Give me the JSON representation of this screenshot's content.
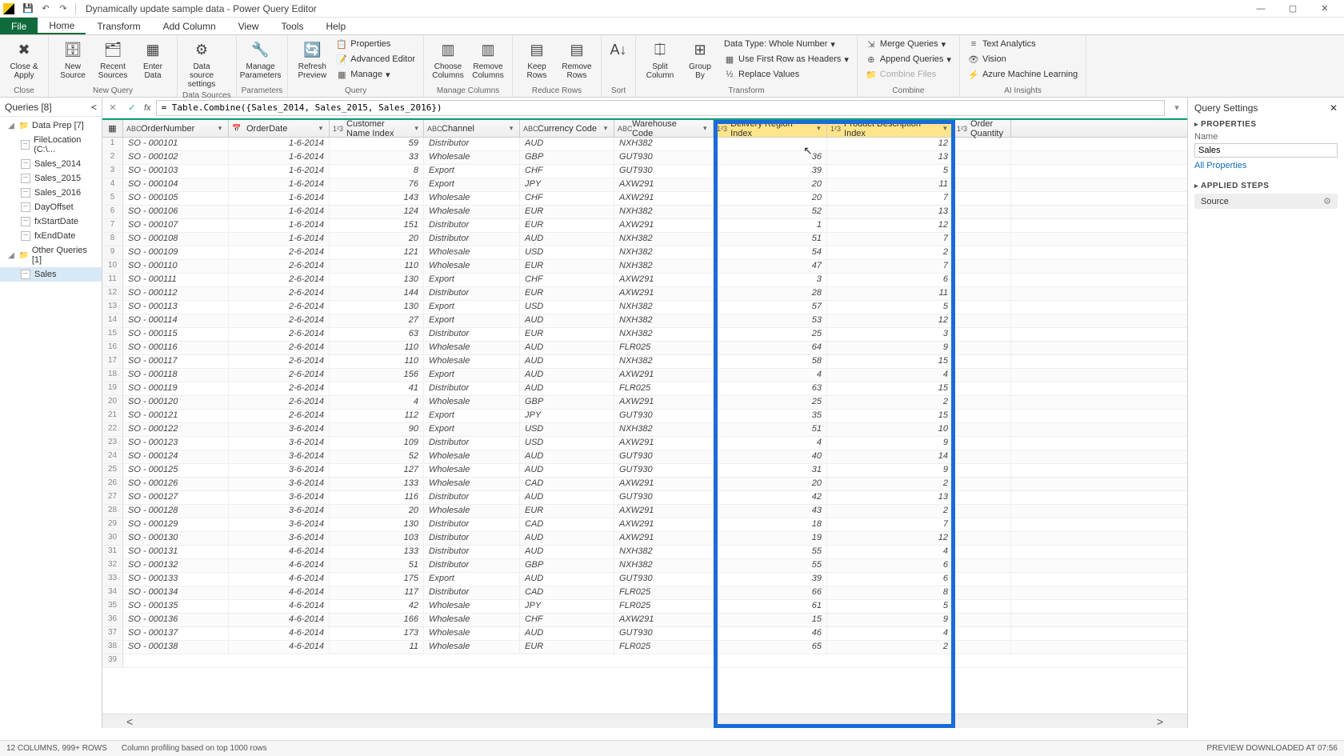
{
  "window": {
    "title": "Dynamically update sample data - Power Query Editor"
  },
  "tabs": {
    "file": "File",
    "home": "Home",
    "transform": "Transform",
    "addcol": "Add Column",
    "view": "View",
    "tools": "Tools",
    "help": "Help"
  },
  "ribbon": {
    "close_apply": "Close &\nApply",
    "close_group": "Close",
    "new_source": "New\nSource",
    "recent_sources": "Recent\nSources",
    "enter_data": "Enter\nData",
    "new_query_group": "New Query",
    "ds_settings": "Data source\nsettings",
    "ds_group": "Data Sources",
    "manage_params": "Manage\nParameters",
    "params_group": "Parameters",
    "refresh": "Refresh\nPreview",
    "properties": "Properties",
    "adv_editor": "Advanced Editor",
    "manage": "Manage",
    "query_group": "Query",
    "choose_cols": "Choose\nColumns",
    "remove_cols": "Remove\nColumns",
    "mc_group": "Manage Columns",
    "keep_rows": "Keep\nRows",
    "remove_rows": "Remove\nRows",
    "rr_group": "Reduce Rows",
    "sort_group": "Sort",
    "split_col": "Split\nColumn",
    "group_by": "Group\nBy",
    "datatype": "Data Type: Whole Number",
    "first_row": "Use First Row as Headers",
    "replace": "Replace Values",
    "transform_group": "Transform",
    "merge_q": "Merge Queries",
    "append_q": "Append Queries",
    "combine_files": "Combine Files",
    "combine_group": "Combine",
    "text_an": "Text Analytics",
    "vision": "Vision",
    "azure_ml": "Azure Machine Learning",
    "ai_group": "AI Insights"
  },
  "queries": {
    "header": "Queries [8]",
    "folder1": "Data Prep [7]",
    "items1": [
      "FileLocation (C:\\...",
      "Sales_2014",
      "Sales_2015",
      "Sales_2016",
      "DayOffset",
      "fxStartDate",
      "fxEndDate"
    ],
    "folder2": "Other Queries [1]",
    "items2": [
      "Sales"
    ]
  },
  "formula": "= Table.Combine({Sales_2014, Sales_2015, Sales_2016})",
  "columns": {
    "ordernum": "OrderNumber",
    "date": "OrderDate",
    "custidx": "Customer Name Index",
    "channel": "Channel",
    "curr": "Currency Code",
    "wh": "Warehouse Code",
    "delidx": "Delivery Region Index",
    "prodidx": "Product Description Index",
    "qty": "Order Quantity"
  },
  "rows": [
    {
      "n": 1,
      "on": "SO - 000101",
      "dt": "1-6-2014",
      "ci": 59,
      "ch": "Distributor",
      "cc": "AUD",
      "wh": "NXH382",
      "di": "",
      "pi": 12
    },
    {
      "n": 2,
      "on": "SO - 000102",
      "dt": "1-6-2014",
      "ci": 33,
      "ch": "Wholesale",
      "cc": "GBP",
      "wh": "GUT930",
      "di": 36,
      "pi": 13
    },
    {
      "n": 3,
      "on": "SO - 000103",
      "dt": "1-6-2014",
      "ci": 8,
      "ch": "Export",
      "cc": "CHF",
      "wh": "GUT930",
      "di": 39,
      "pi": 5
    },
    {
      "n": 4,
      "on": "SO - 000104",
      "dt": "1-6-2014",
      "ci": 76,
      "ch": "Export",
      "cc": "JPY",
      "wh": "AXW291",
      "di": 20,
      "pi": 11
    },
    {
      "n": 5,
      "on": "SO - 000105",
      "dt": "1-6-2014",
      "ci": 143,
      "ch": "Wholesale",
      "cc": "CHF",
      "wh": "AXW291",
      "di": 20,
      "pi": 7
    },
    {
      "n": 6,
      "on": "SO - 000106",
      "dt": "1-6-2014",
      "ci": 124,
      "ch": "Wholesale",
      "cc": "EUR",
      "wh": "NXH382",
      "di": 52,
      "pi": 13
    },
    {
      "n": 7,
      "on": "SO - 000107",
      "dt": "1-6-2014",
      "ci": 151,
      "ch": "Distributor",
      "cc": "EUR",
      "wh": "AXW291",
      "di": 1,
      "pi": 12
    },
    {
      "n": 8,
      "on": "SO - 000108",
      "dt": "1-6-2014",
      "ci": 20,
      "ch": "Distributor",
      "cc": "AUD",
      "wh": "NXH382",
      "di": 51,
      "pi": 7
    },
    {
      "n": 9,
      "on": "SO - 000109",
      "dt": "2-6-2014",
      "ci": 121,
      "ch": "Wholesale",
      "cc": "USD",
      "wh": "NXH382",
      "di": 54,
      "pi": 2
    },
    {
      "n": 10,
      "on": "SO - 000110",
      "dt": "2-6-2014",
      "ci": 110,
      "ch": "Wholesale",
      "cc": "EUR",
      "wh": "NXH382",
      "di": 47,
      "pi": 7
    },
    {
      "n": 11,
      "on": "SO - 000111",
      "dt": "2-6-2014",
      "ci": 130,
      "ch": "Export",
      "cc": "CHF",
      "wh": "AXW291",
      "di": 3,
      "pi": 6
    },
    {
      "n": 12,
      "on": "SO - 000112",
      "dt": "2-6-2014",
      "ci": 144,
      "ch": "Distributor",
      "cc": "EUR",
      "wh": "AXW291",
      "di": 28,
      "pi": 11
    },
    {
      "n": 13,
      "on": "SO - 000113",
      "dt": "2-6-2014",
      "ci": 130,
      "ch": "Export",
      "cc": "USD",
      "wh": "NXH382",
      "di": 57,
      "pi": 5
    },
    {
      "n": 14,
      "on": "SO - 000114",
      "dt": "2-6-2014",
      "ci": 27,
      "ch": "Export",
      "cc": "AUD",
      "wh": "NXH382",
      "di": 53,
      "pi": 12
    },
    {
      "n": 15,
      "on": "SO - 000115",
      "dt": "2-6-2014",
      "ci": 63,
      "ch": "Distributor",
      "cc": "EUR",
      "wh": "NXH382",
      "di": 25,
      "pi": 3
    },
    {
      "n": 16,
      "on": "SO - 000116",
      "dt": "2-6-2014",
      "ci": 110,
      "ch": "Wholesale",
      "cc": "AUD",
      "wh": "FLR025",
      "di": 64,
      "pi": 9
    },
    {
      "n": 17,
      "on": "SO - 000117",
      "dt": "2-6-2014",
      "ci": 110,
      "ch": "Wholesale",
      "cc": "AUD",
      "wh": "NXH382",
      "di": 58,
      "pi": 15
    },
    {
      "n": 18,
      "on": "SO - 000118",
      "dt": "2-6-2014",
      "ci": 156,
      "ch": "Export",
      "cc": "AUD",
      "wh": "AXW291",
      "di": 4,
      "pi": 4
    },
    {
      "n": 19,
      "on": "SO - 000119",
      "dt": "2-6-2014",
      "ci": 41,
      "ch": "Distributor",
      "cc": "AUD",
      "wh": "FLR025",
      "di": 63,
      "pi": 15
    },
    {
      "n": 20,
      "on": "SO - 000120",
      "dt": "2-6-2014",
      "ci": 4,
      "ch": "Wholesale",
      "cc": "GBP",
      "wh": "AXW291",
      "di": 25,
      "pi": 2
    },
    {
      "n": 21,
      "on": "SO - 000121",
      "dt": "2-6-2014",
      "ci": 112,
      "ch": "Export",
      "cc": "JPY",
      "wh": "GUT930",
      "di": 35,
      "pi": 15
    },
    {
      "n": 22,
      "on": "SO - 000122",
      "dt": "3-6-2014",
      "ci": 90,
      "ch": "Export",
      "cc": "USD",
      "wh": "NXH382",
      "di": 51,
      "pi": 10
    },
    {
      "n": 23,
      "on": "SO - 000123",
      "dt": "3-6-2014",
      "ci": 109,
      "ch": "Distributor",
      "cc": "USD",
      "wh": "AXW291",
      "di": 4,
      "pi": 9
    },
    {
      "n": 24,
      "on": "SO - 000124",
      "dt": "3-6-2014",
      "ci": 52,
      "ch": "Wholesale",
      "cc": "AUD",
      "wh": "GUT930",
      "di": 40,
      "pi": 14
    },
    {
      "n": 25,
      "on": "SO - 000125",
      "dt": "3-6-2014",
      "ci": 127,
      "ch": "Wholesale",
      "cc": "AUD",
      "wh": "GUT930",
      "di": 31,
      "pi": 9
    },
    {
      "n": 26,
      "on": "SO - 000126",
      "dt": "3-6-2014",
      "ci": 133,
      "ch": "Wholesale",
      "cc": "CAD",
      "wh": "AXW291",
      "di": 20,
      "pi": 2
    },
    {
      "n": 27,
      "on": "SO - 000127",
      "dt": "3-6-2014",
      "ci": 116,
      "ch": "Distributor",
      "cc": "AUD",
      "wh": "GUT930",
      "di": 42,
      "pi": 13
    },
    {
      "n": 28,
      "on": "SO - 000128",
      "dt": "3-6-2014",
      "ci": 20,
      "ch": "Wholesale",
      "cc": "EUR",
      "wh": "AXW291",
      "di": 43,
      "pi": 2
    },
    {
      "n": 29,
      "on": "SO - 000129",
      "dt": "3-6-2014",
      "ci": 130,
      "ch": "Distributor",
      "cc": "CAD",
      "wh": "AXW291",
      "di": 18,
      "pi": 7
    },
    {
      "n": 30,
      "on": "SO - 000130",
      "dt": "3-6-2014",
      "ci": 103,
      "ch": "Distributor",
      "cc": "AUD",
      "wh": "AXW291",
      "di": 19,
      "pi": 12
    },
    {
      "n": 31,
      "on": "SO - 000131",
      "dt": "4-6-2014",
      "ci": 133,
      "ch": "Distributor",
      "cc": "AUD",
      "wh": "NXH382",
      "di": 55,
      "pi": 4
    },
    {
      "n": 32,
      "on": "SO - 000132",
      "dt": "4-6-2014",
      "ci": 51,
      "ch": "Distributor",
      "cc": "GBP",
      "wh": "NXH382",
      "di": 55,
      "pi": 6
    },
    {
      "n": 33,
      "on": "SO - 000133",
      "dt": "4-6-2014",
      "ci": 175,
      "ch": "Export",
      "cc": "AUD",
      "wh": "GUT930",
      "di": 39,
      "pi": 6
    },
    {
      "n": 34,
      "on": "SO - 000134",
      "dt": "4-6-2014",
      "ci": 117,
      "ch": "Distributor",
      "cc": "CAD",
      "wh": "FLR025",
      "di": 66,
      "pi": 8
    },
    {
      "n": 35,
      "on": "SO - 000135",
      "dt": "4-6-2014",
      "ci": 42,
      "ch": "Wholesale",
      "cc": "JPY",
      "wh": "FLR025",
      "di": 61,
      "pi": 5
    },
    {
      "n": 36,
      "on": "SO - 000136",
      "dt": "4-6-2014",
      "ci": 166,
      "ch": "Wholesale",
      "cc": "CHF",
      "wh": "AXW291",
      "di": 15,
      "pi": 9
    },
    {
      "n": 37,
      "on": "SO - 000137",
      "dt": "4-6-2014",
      "ci": 173,
      "ch": "Wholesale",
      "cc": "AUD",
      "wh": "GUT930",
      "di": 46,
      "pi": 4
    },
    {
      "n": 38,
      "on": "SO - 000138",
      "dt": "4-6-2014",
      "ci": 11,
      "ch": "Wholesale",
      "cc": "EUR",
      "wh": "FLR025",
      "di": 65,
      "pi": 2
    }
  ],
  "extra_row_num": "39",
  "settings": {
    "title": "Query Settings",
    "properties": "PROPERTIES",
    "name_label": "Name",
    "name_value": "Sales",
    "all_props": "All Properties",
    "applied": "APPLIED STEPS",
    "step1": "Source"
  },
  "status": {
    "left1": "12 COLUMNS, 999+ ROWS",
    "left2": "Column profiling based on top 1000 rows",
    "right": "PREVIEW DOWNLOADED AT 07:56"
  }
}
